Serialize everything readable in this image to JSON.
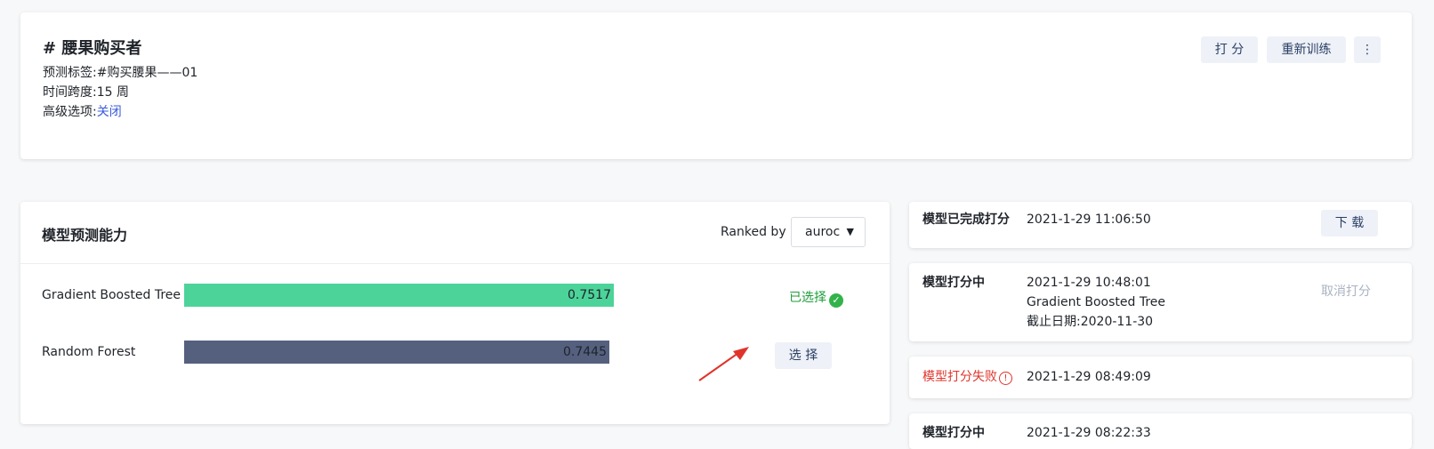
{
  "header": {
    "title": "# 腰果购买者",
    "meta": [
      {
        "label": "预测标签:",
        "value": "#购买腰果——01"
      },
      {
        "label": "时间跨度:",
        "value": "15 周"
      },
      {
        "label": "高级选项:",
        "value": "关闭"
      }
    ],
    "buttons": {
      "score": "打 分",
      "retrain": "重新训练",
      "more": "⋮"
    }
  },
  "model_panel": {
    "title": "模型预测能力",
    "ranked_by_label": "Ranked by",
    "metric": "auroc",
    "models": [
      {
        "name": "Gradient Boosted Tree",
        "value": "0.7517",
        "score": 0.7517,
        "color": "#4cd39a",
        "selected": true
      },
      {
        "name": "Random Forest",
        "value": "0.7445",
        "score": 0.7445,
        "color": "#55607f",
        "selected": false
      }
    ],
    "selected_label": "已选择",
    "select_button": "选 择"
  },
  "status_list": [
    {
      "status": "模型已完成打分",
      "time": "2021-1-29 11:06:50",
      "action": "下 载"
    },
    {
      "status": "模型打分中",
      "time": "2021-1-29 10:48:01",
      "model": "Gradient Boosted Tree",
      "cutoff": "截止日期:2020-11-30",
      "action": "取消打分"
    },
    {
      "status": "模型打分失败",
      "time": "2021-1-29 08:49:09"
    },
    {
      "status": "模型打分中",
      "time": "2021-1-29 08:22:33"
    }
  ],
  "colors": {
    "accent": "#3b5bdb",
    "success": "#31b34a",
    "error": "#e0342b",
    "button_bg": "#eef1f7"
  }
}
